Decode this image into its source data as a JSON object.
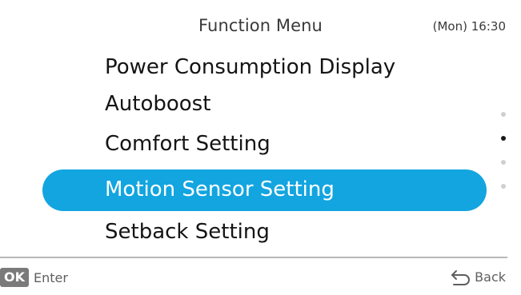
{
  "header": {
    "title": "Function Menu",
    "day": "(Mon)",
    "time": "16:30"
  },
  "menu": {
    "items": [
      {
        "label": "Power Consumption Display",
        "selected": false
      },
      {
        "label": "Autoboost",
        "selected": false
      },
      {
        "label": "Comfort Setting",
        "selected": false
      },
      {
        "label": "Motion Sensor Setting",
        "selected": true
      },
      {
        "label": "Setback Setting",
        "selected": false
      }
    ],
    "page_count": 4,
    "current_page": 2
  },
  "footer": {
    "ok_key": "OK",
    "enter_label": "Enter",
    "back_label": "Back",
    "back_icon": "back-arrow-icon"
  },
  "colors": {
    "highlight": "#12a5e0",
    "highlight_text": "#ffffff",
    "ok_key_bg": "#7a7a7a",
    "active_dot": "#1a1a1a",
    "inactive_dot": "#cfcfcf"
  }
}
